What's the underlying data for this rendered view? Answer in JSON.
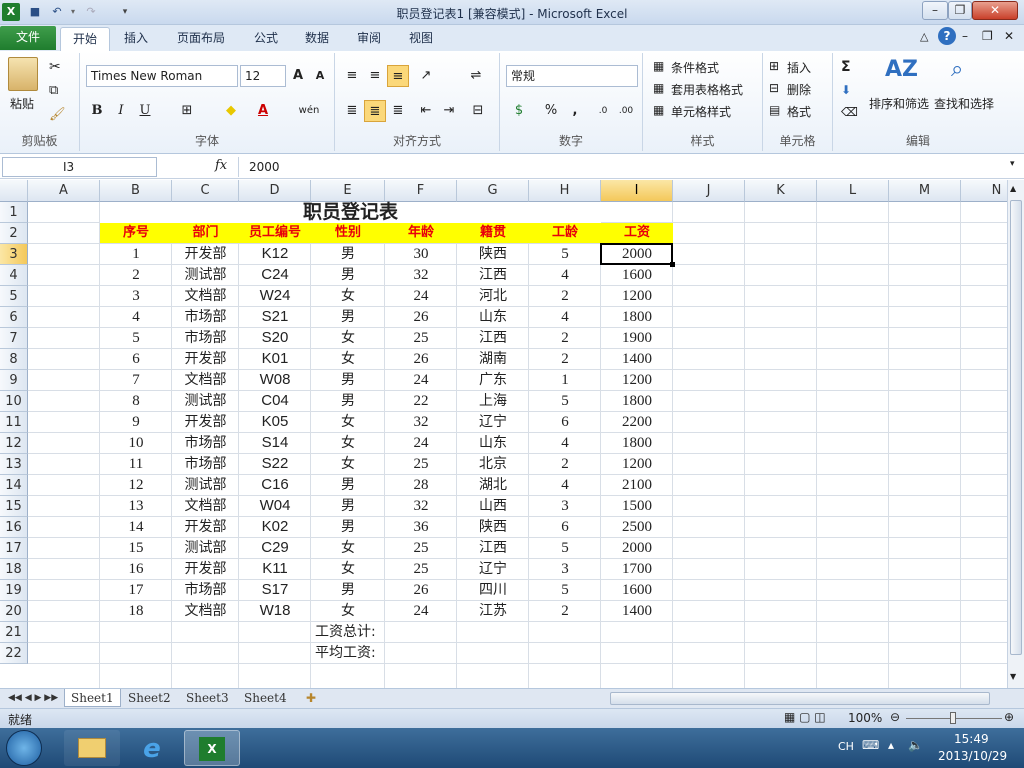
{
  "window": {
    "title": "职员登记表1  [兼容模式]  -  Microsoft Excel"
  },
  "tabs": [
    "文件",
    "开始",
    "插入",
    "页面布局",
    "公式",
    "数据",
    "审阅",
    "视图"
  ],
  "ribbon": {
    "clipboard": {
      "paste": "粘贴",
      "label": "剪贴板"
    },
    "font": {
      "name": "Times New Roman",
      "size": "12",
      "label": "字体",
      "bold": "B",
      "italic": "I",
      "underline": "U",
      "grow": "A",
      "shrink": "A",
      "phonetic": "wén"
    },
    "alignment": {
      "label": "对齐方式"
    },
    "number": {
      "format": "常规",
      "label": "数字",
      "percent": "%",
      "comma": ","
    },
    "styles": {
      "conditional": "条件格式",
      "table": "套用表格格式",
      "cell": "单元格样式",
      "label": "样式"
    },
    "cells": {
      "insert": "插入",
      "delete": "删除",
      "format": "格式",
      "label": "单元格"
    },
    "editing": {
      "sum": "Σ",
      "sort": "排序和筛选",
      "find": "查找和选择",
      "label": "编辑"
    }
  },
  "formula_bar": {
    "name_box": "I3",
    "fx": "fx",
    "value": "2000"
  },
  "columns": [
    "A",
    "B",
    "C",
    "D",
    "E",
    "F",
    "G",
    "H",
    "I",
    "J",
    "K",
    "L",
    "M",
    "N"
  ],
  "rows": [
    "1",
    "2",
    "3",
    "4",
    "5",
    "6",
    "7",
    "8",
    "9",
    "10",
    "11",
    "12",
    "13",
    "14",
    "15",
    "16",
    "17",
    "18",
    "19",
    "20",
    "21",
    "22"
  ],
  "sheet": {
    "title": "职员登记表",
    "headers": [
      "序号",
      "部门",
      "员工编号",
      "性别",
      "年龄",
      "籍贯",
      "工龄",
      "工资"
    ],
    "records": [
      [
        "1",
        "开发部",
        "K12",
        "男",
        "30",
        "陕西",
        "5",
        "2000"
      ],
      [
        "2",
        "测试部",
        "C24",
        "男",
        "32",
        "江西",
        "4",
        "1600"
      ],
      [
        "3",
        "文档部",
        "W24",
        "女",
        "24",
        "河北",
        "2",
        "1200"
      ],
      [
        "4",
        "市场部",
        "S21",
        "男",
        "26",
        "山东",
        "4",
        "1800"
      ],
      [
        "5",
        "市场部",
        "S20",
        "女",
        "25",
        "江西",
        "2",
        "1900"
      ],
      [
        "6",
        "开发部",
        "K01",
        "女",
        "26",
        "湖南",
        "2",
        "1400"
      ],
      [
        "7",
        "文档部",
        "W08",
        "男",
        "24",
        "广东",
        "1",
        "1200"
      ],
      [
        "8",
        "测试部",
        "C04",
        "男",
        "22",
        "上海",
        "5",
        "1800"
      ],
      [
        "9",
        "开发部",
        "K05",
        "女",
        "32",
        "辽宁",
        "6",
        "2200"
      ],
      [
        "10",
        "市场部",
        "S14",
        "女",
        "24",
        "山东",
        "4",
        "1800"
      ],
      [
        "11",
        "市场部",
        "S22",
        "女",
        "25",
        "北京",
        "2",
        "1200"
      ],
      [
        "12",
        "测试部",
        "C16",
        "男",
        "28",
        "湖北",
        "4",
        "2100"
      ],
      [
        "13",
        "文档部",
        "W04",
        "男",
        "32",
        "山西",
        "3",
        "1500"
      ],
      [
        "14",
        "开发部",
        "K02",
        "男",
        "36",
        "陕西",
        "6",
        "2500"
      ],
      [
        "15",
        "测试部",
        "C29",
        "女",
        "25",
        "江西",
        "5",
        "2000"
      ],
      [
        "16",
        "开发部",
        "K11",
        "女",
        "25",
        "辽宁",
        "3",
        "1700"
      ],
      [
        "17",
        "市场部",
        "S17",
        "男",
        "26",
        "四川",
        "5",
        "1600"
      ],
      [
        "18",
        "文档部",
        "W18",
        "女",
        "24",
        "江苏",
        "2",
        "1400"
      ]
    ],
    "total_label": "工资总计:",
    "avg_label": "平均工资:"
  },
  "sheet_tabs": [
    "Sheet1",
    "Sheet2",
    "Sheet3",
    "Sheet4"
  ],
  "status": {
    "ready": "就绪",
    "zoom": "100%"
  },
  "taskbar": {
    "lang": "CH",
    "time": "15:49",
    "date": "2013/10/29"
  },
  "colors": {
    "header_fill": "#ffff00",
    "header_text": "#e8000b",
    "selection": "#000000"
  }
}
